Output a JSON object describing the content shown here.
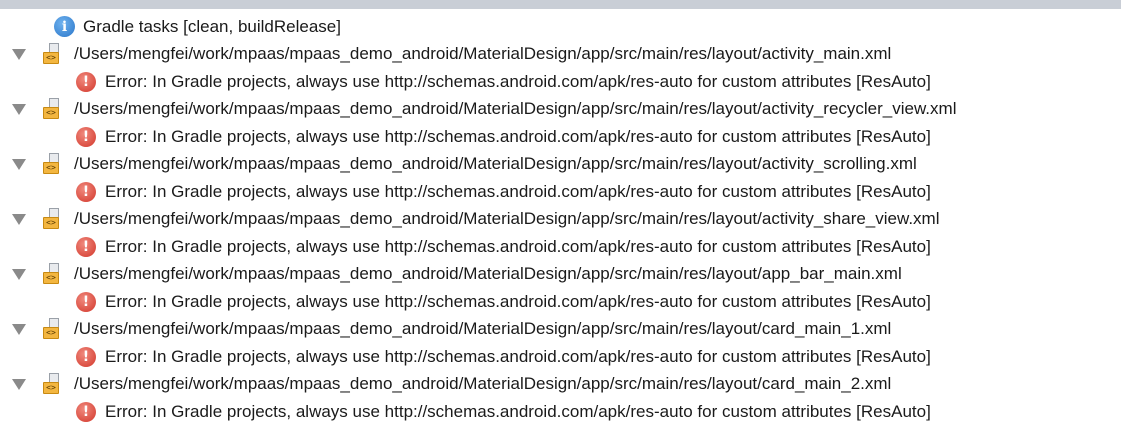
{
  "header": {
    "gradle_tasks": "Gradle tasks [clean, buildRelease]"
  },
  "icons": {
    "info": "info-icon",
    "file": "xml-file-icon",
    "error": "error-icon",
    "expand": "triangle-down-icon"
  },
  "items": [
    {
      "path": "/Users/mengfei/work/mpaas/mpaas_demo_android/MaterialDesign/app/src/main/res/layout/activity_main.xml",
      "error": "Error: In Gradle projects, always use http://schemas.android.com/apk/res-auto for custom attributes [ResAuto]"
    },
    {
      "path": "/Users/mengfei/work/mpaas/mpaas_demo_android/MaterialDesign/app/src/main/res/layout/activity_recycler_view.xml",
      "error": "Error: In Gradle projects, always use http://schemas.android.com/apk/res-auto for custom attributes [ResAuto]"
    },
    {
      "path": "/Users/mengfei/work/mpaas/mpaas_demo_android/MaterialDesign/app/src/main/res/layout/activity_scrolling.xml",
      "error": "Error: In Gradle projects, always use http://schemas.android.com/apk/res-auto for custom attributes [ResAuto]"
    },
    {
      "path": "/Users/mengfei/work/mpaas/mpaas_demo_android/MaterialDesign/app/src/main/res/layout/activity_share_view.xml",
      "error": "Error: In Gradle projects, always use http://schemas.android.com/apk/res-auto for custom attributes [ResAuto]"
    },
    {
      "path": "/Users/mengfei/work/mpaas/mpaas_demo_android/MaterialDesign/app/src/main/res/layout/app_bar_main.xml",
      "error": "Error: In Gradle projects, always use http://schemas.android.com/apk/res-auto for custom attributes [ResAuto]"
    },
    {
      "path": "/Users/mengfei/work/mpaas/mpaas_demo_android/MaterialDesign/app/src/main/res/layout/card_main_1.xml",
      "error": "Error: In Gradle projects, always use http://schemas.android.com/apk/res-auto for custom attributes [ResAuto]"
    },
    {
      "path": "/Users/mengfei/work/mpaas/mpaas_demo_android/MaterialDesign/app/src/main/res/layout/card_main_2.xml",
      "error": "Error: In Gradle projects, always use http://schemas.android.com/apk/res-auto for custom attributes [ResAuto]"
    }
  ]
}
